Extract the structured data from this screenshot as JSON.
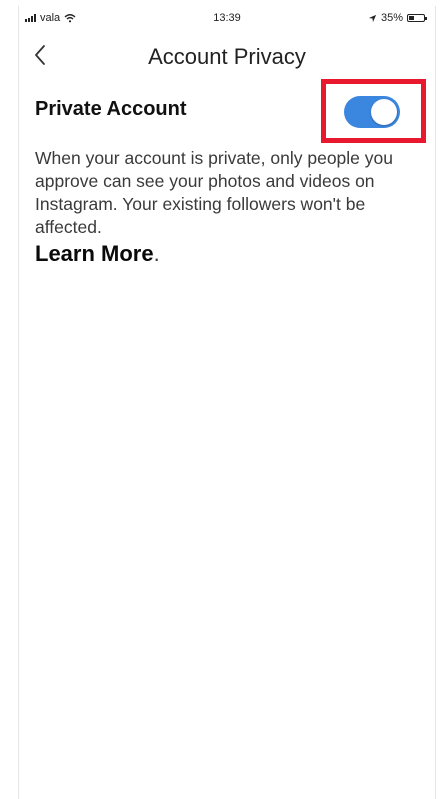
{
  "status_bar": {
    "carrier": "vala",
    "time": "13:39",
    "battery_text": "35%",
    "battery_level": 0.35
  },
  "nav": {
    "title": "Account Privacy"
  },
  "setting": {
    "label": "Private Account",
    "enabled": true
  },
  "description": "When your account is private, only people you approve can see your photos and videos on Instagram. Your existing followers won't be affected.",
  "learn_more": {
    "label": "Learn More",
    "suffix": "."
  },
  "colors": {
    "toggle_on": "#3b87e0",
    "highlight": "#e8182f"
  },
  "icons": {
    "back": "chevron-left-icon",
    "location": "location-arrow-icon",
    "wifi": "wifi-icon",
    "battery": "battery-icon",
    "signal": "signal-bars-icon"
  }
}
